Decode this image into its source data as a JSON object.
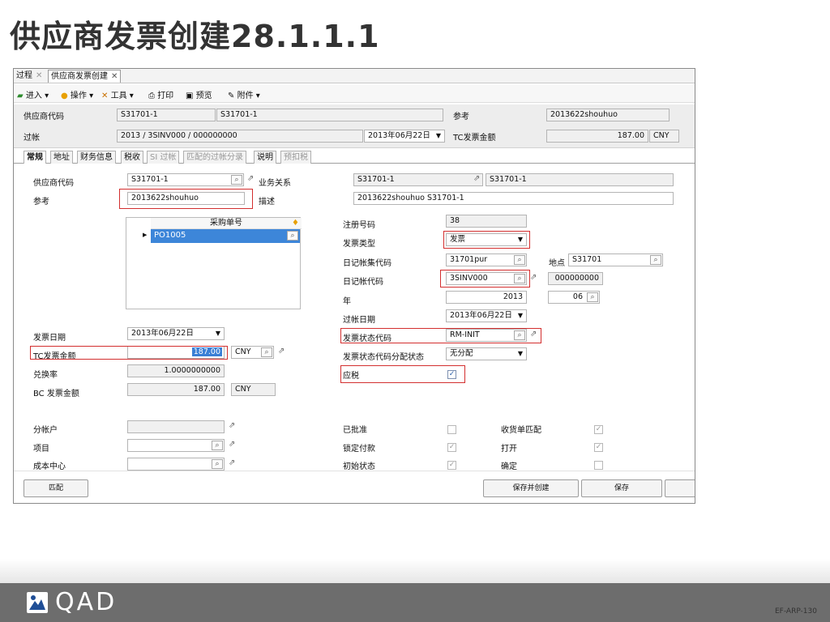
{
  "slide": {
    "title": "供应商发票创建28.1.1.1",
    "number": "EF-ARP-130"
  },
  "tabs": {
    "process": "过程",
    "create": "供应商发票创建"
  },
  "toolbar": {
    "enter": "进入 ▾",
    "actions": "操作 ▾",
    "tools": "工具 ▾",
    "print": "打印",
    "preview": "预览",
    "attach": "附件 ▾"
  },
  "header": {
    "supplier_label": "供应商代码",
    "supplier_value": "S31701-1",
    "supplier_desc": "S31701-1",
    "ref_label": "参考",
    "ref_value": "2013622shouhuo",
    "posting_label": "过帐",
    "posting_value": "2013 / 3SINV000 / 000000000",
    "posting_date": "2013年06月22日",
    "tc_label": "TC发票金额",
    "tc_value": "187.00",
    "tc_currency": "CNY"
  },
  "form_tabs": [
    "常规",
    "地址",
    "财务信息",
    "税收",
    "SI 过帐",
    "匹配的过帐分录",
    "说明",
    "预扣税"
  ],
  "form": {
    "supplier_label": "供应商代码",
    "supplier_value": "S31701-1",
    "ref_label": "参考",
    "ref_value": "2013622shouhuo",
    "po_header": "采购单号",
    "po_row": "PO1005",
    "invoice_date_label": "发票日期",
    "invoice_date_value": "2013年06月22日",
    "tc_label": "TC发票金额",
    "tc_value": "187.00",
    "tc_currency": "CNY",
    "rate_label": "兑换率",
    "rate_value": "1.0000000000",
    "bc_label": "BC 发票金额",
    "bc_value": "187.00",
    "bc_currency": "CNY",
    "sub_label": "分帐户",
    "project_label": "项目",
    "cost_label": "成本中心",
    "biz_label": "业务关系",
    "biz_value1": "S31701-1",
    "biz_value2": "S31701-1",
    "desc_label": "描述",
    "desc_value": "2013622shouhuo S31701-1",
    "reg_label": "注册号码",
    "reg_value": "38",
    "type_label": "发票类型",
    "type_value": "发票",
    "daybook_set_label": "日记帐集代码",
    "daybook_set_value": "31701pur",
    "site_label": "地点",
    "site_value": "S31701",
    "daybook_label": "日记帐代码",
    "daybook_value": "3SINV000",
    "daybook_num": "000000000",
    "year_label": "年",
    "year_value": "2013",
    "period_value": "06",
    "postdate_label": "过帐日期",
    "postdate_value": "2013年06月22日",
    "status_label": "发票状态代码",
    "status_value": "RM-INIT",
    "alloc_label": "发票状态代码分配状态",
    "alloc_value": "无分配",
    "taxable_label": "应税",
    "approved_label": "已批准",
    "locked_label": "锁定付款",
    "initial_label": "初始状态",
    "receipt_match_label": "收货单匹配",
    "open_label": "打开",
    "confirm_label": "确定"
  },
  "buttons": {
    "match": "匹配",
    "save_create": "保存并创建",
    "save": "保存"
  },
  "logo": {
    "text": "QAD"
  }
}
